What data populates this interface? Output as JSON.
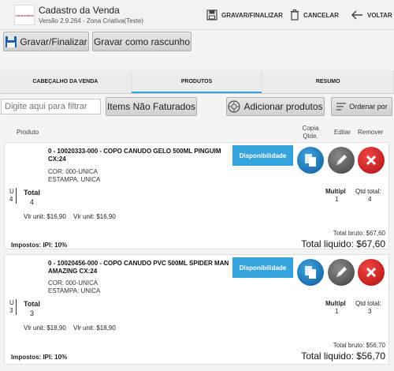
{
  "header": {
    "title": "Cadastro da Venda",
    "subtitle": "Versão 2.9.264 - Zona Criativa(Teste)",
    "actions": {
      "save": "GRAVAR/FINALIZAR",
      "cancel": "CANCELAR",
      "back": "VOLTAR"
    }
  },
  "toolbar": {
    "save_label": "Gravar/Finalizar",
    "draft_label": "Gravar como rascunho"
  },
  "tabs": [
    {
      "label": "CABEÇALHO DA VENDA",
      "active": false
    },
    {
      "label": "PRODUTOS",
      "active": true
    },
    {
      "label": "RESUMO",
      "active": false
    }
  ],
  "filter": {
    "placeholder": "Digite aqui para filtrar"
  },
  "buttons": {
    "not_invoiced": "Items Não Faturados",
    "add_products": "Adicionar produtos",
    "sort": "Ordenar por"
  },
  "columns": {
    "product": "Produto",
    "copy": "Copia Qtde.",
    "edit": "Editar",
    "remove": "Remover"
  },
  "items": [
    {
      "description": "0 - 10020333-000 - COPO CANUDO GELO  500ML PINGUIM CX:24",
      "color": "COR: 000-UNICA",
      "print": "ESTAMPA: UNICA",
      "availability": "Disponibilidade",
      "u_label": "U",
      "u_value": "4",
      "total_label": "Total",
      "total_value": "4",
      "mult_label": "Multipl",
      "mult_value": "1",
      "qty_label": "Qtd total:",
      "qty_value": "4",
      "unit1": "Vlr unit: $16,90",
      "unit2": "Vlr unit: $16,90",
      "gross": "Total bruto: $67,60",
      "taxes": "Impostos: IPI: 10%",
      "net": "Total liquido: $67,60"
    },
    {
      "description": "0 - 10020456-000 - COPO CANUDO PVC 500ML SPIDER MAN AMAZING CX:24",
      "color": "COR: 000-UNICA",
      "print": "ESTAMPA: UNICA",
      "availability": "Disponibilidade",
      "u_label": "U",
      "u_value": "3",
      "total_label": "Total",
      "total_value": "3",
      "mult_label": "Multipl",
      "mult_value": "1",
      "qty_label": "Qtd total:",
      "qty_value": "3",
      "unit1": "Vlr unit: $18,90",
      "unit2": "Vlr unit: $18,90",
      "gross": "Total bruto: $56,70",
      "taxes": "Impostos: IPI: 10%",
      "net": "Total liquido: $56,70"
    }
  ],
  "colors": {
    "accent": "#35a4dd",
    "delete": "#d42020",
    "copy": "#1a73b8"
  }
}
